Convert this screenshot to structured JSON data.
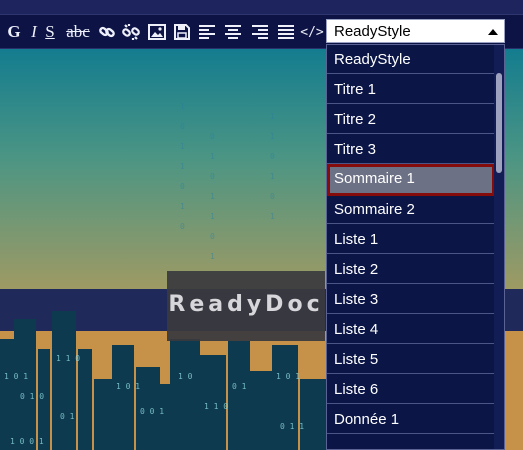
{
  "toolbar": {
    "bold": "G",
    "italic": "I",
    "underline": "S",
    "strike": "abc",
    "code": "</>"
  },
  "banner": {
    "text": "ReadyDoc"
  },
  "style_select": {
    "value": "ReadyStyle"
  },
  "dropdown": {
    "options": [
      "ReadyStyle",
      "Titre 1",
      "Titre 2",
      "Titre 3",
      "Sommaire 1",
      "Sommaire 2",
      "Liste 1",
      "Liste 2",
      "Liste 3",
      "Liste 4",
      "Liste 5",
      "Liste 6",
      "Donnée 1"
    ],
    "highlighted": "Sommaire 1"
  },
  "colors": {
    "toolbar_bg": "#0d1445",
    "dropdown_bg": "#0b1647",
    "highlight_bg": "#6c7185",
    "highlight_border": "#860b0b"
  }
}
